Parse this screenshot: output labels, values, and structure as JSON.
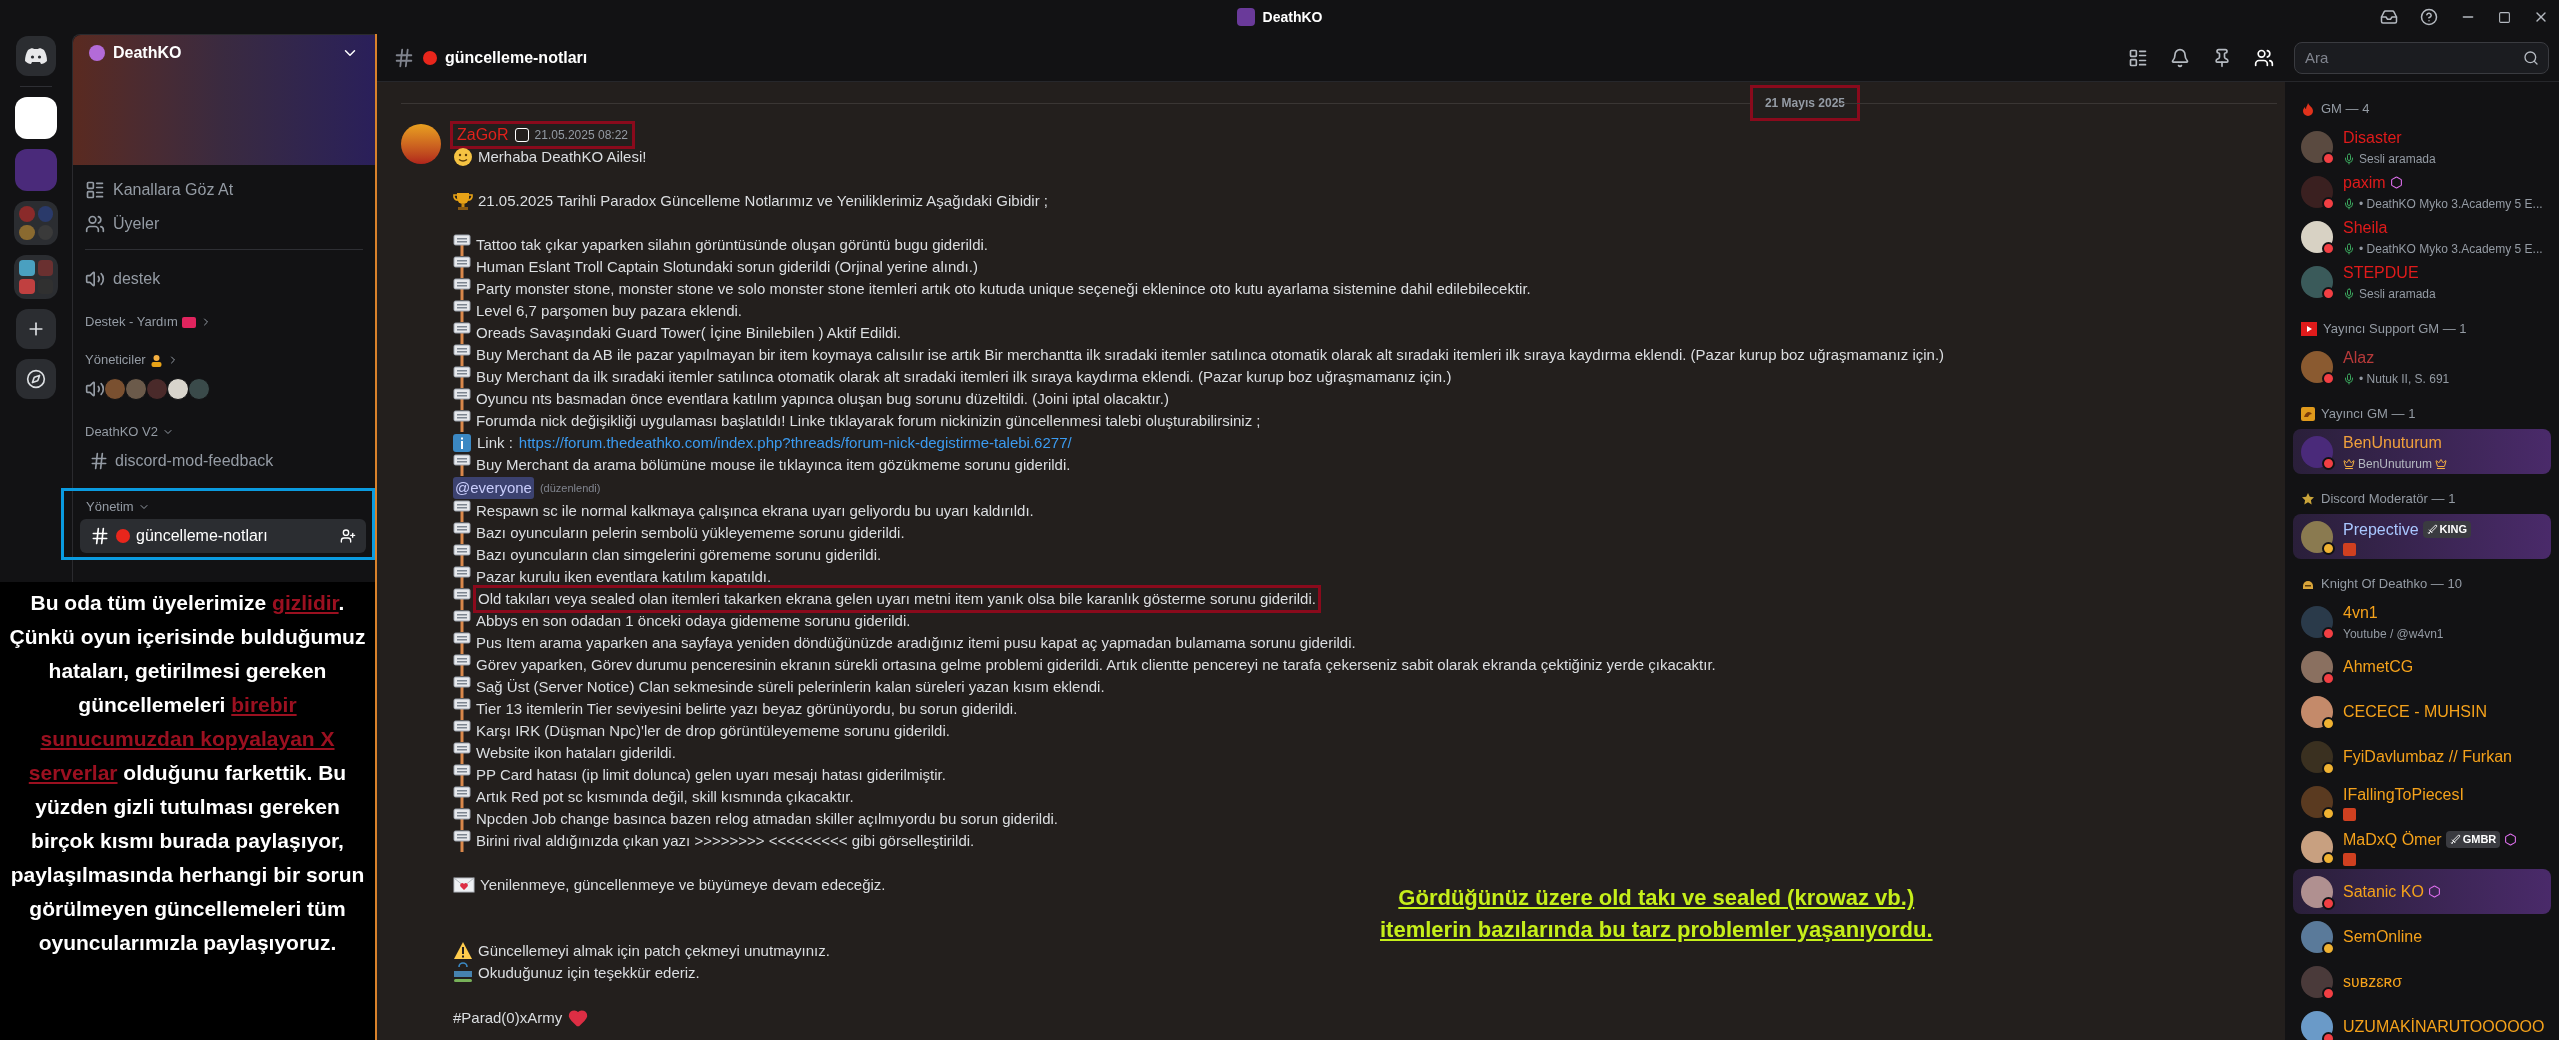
{
  "titlebar": {
    "title": "DeathKO"
  },
  "server": {
    "name": "DeathKO"
  },
  "sidebar": {
    "items": [
      {
        "kind": "browse",
        "label": "Kanallara Göz At"
      },
      {
        "kind": "members",
        "label": "Üyeler"
      },
      {
        "kind": "separator"
      },
      {
        "kind": "voice",
        "label": "destek"
      },
      {
        "kind": "category",
        "label": "Destek - Yardım",
        "expanded": false,
        "emoji": true
      },
      {
        "kind": "category",
        "label": "Yöneticiler",
        "expanded": false,
        "emoji": true
      },
      {
        "kind": "voice-users"
      },
      {
        "kind": "category",
        "label": "DeathKO V2",
        "expanded": true
      },
      {
        "kind": "text",
        "label": "discord-mod-feedback",
        "selected": false
      }
    ],
    "framed_group": [
      {
        "kind": "category",
        "label": "Yönetim",
        "expanded": true
      },
      {
        "kind": "text",
        "label": "güncelleme-notları",
        "selected": true,
        "dot": true
      }
    ]
  },
  "note": [
    {
      "text": "Bu oda tüm üyelerimize ",
      "emphasis": false
    },
    {
      "text": "gizlidir",
      "emphasis": true
    },
    {
      "text": ". Çünkü oyun içerisinde bulduğumuz hataları, getirilmesi gereken güncellemeleri ",
      "emphasis": false
    },
    {
      "text": "birebir sunucumuzdan kopyalayan X serverlar",
      "emphasis": true
    },
    {
      "text": " olduğunu farkettik. Bu yüzden gizli tutulması gereken birçok kısmı burada paylaşıyor, paylaşılmasında herhangi bir sorun görülmeyen güncellemeleri tüm oyuncularımızla paylaşıyoruz.",
      "emphasis": false
    }
  ],
  "channel": {
    "name": "güncelleme-notları"
  },
  "search": {
    "placeholder": "Ara"
  },
  "message": {
    "date": "21 Mayıs 2025",
    "date_highlighted": true,
    "author": "ZaGoR",
    "author_highlighted": true,
    "timestamp": "21.05.2025 08:22",
    "lines": [
      {
        "kind": "greeting",
        "text": "Merhaba DeathKO Ailesi!"
      },
      {
        "kind": "gap"
      },
      {
        "kind": "trophy",
        "text": "21.05.2025 Tarihli Paradox Güncelleme Notlarımız ve Yeniliklerimiz Aşağıdaki Gibidir ;"
      },
      {
        "kind": "gap"
      },
      {
        "kind": "bullet",
        "text": "Tattoo tak çıkar yaparken silahın görüntüsünde oluşan görüntü bugu giderildi.",
        "highlighted": false
      },
      {
        "kind": "bullet",
        "text": "Human Eslant Troll Captain Slotundaki sorun giderildi (Orjinal yerine alındı.)",
        "highlighted": false
      },
      {
        "kind": "bullet",
        "text": "Party monster stone, monster stone ve solo monster stone itemleri artık oto kutuda unique seçeneği eklenince oto kutu ayarlama sistemine dahil edilebilecektir.",
        "highlighted": false
      },
      {
        "kind": "bullet",
        "text": "Level 6,7 parşomen buy pazara eklendi.",
        "highlighted": false
      },
      {
        "kind": "bullet",
        "text": "Oreads Savaşındaki Guard Tower( İçine Binilebilen ) Aktif Edildi.",
        "highlighted": false
      },
      {
        "kind": "bullet",
        "text": "Buy Merchant da AB ile pazar yapılmayan bir item koymaya calısılır ise artık Bir merchantta ilk sıradaki itemler satılınca otomatik olarak alt sıradaki itemleri ilk sıraya kaydırma eklendi. (Pazar kurup boz uğraşmamanız için.)",
        "highlighted": false
      },
      {
        "kind": "bullet",
        "text": "Buy Merchant da ilk sıradaki itemler satılınca otomatik olarak alt sıradaki itemleri ilk sıraya kaydırma eklendi. (Pazar kurup boz uğraşmamanız için.)",
        "highlighted": false
      },
      {
        "kind": "bullet",
        "text": "Oyuncu nts basmadan önce eventlara katılım yapınca oluşan bug sorunu düzeltildi. (Joini iptal olacaktır.)",
        "highlighted": false
      },
      {
        "kind": "bullet",
        "text": "Forumda nick değişikliği uygulaması başlatıldı! Linke tıklayarak forum nickinizin güncellenmesi talebi oluşturabilirsiniz ;",
        "highlighted": false
      },
      {
        "kind": "link",
        "text": "Link :",
        "url": "https://forum.thedeathko.com/index.php?threads/forum-nick-degistirme-talebi.6277/"
      },
      {
        "kind": "bullet",
        "text": "Buy Merchant da arama bölümüne mouse ile tıklayınca item gözükmeme sorunu giderildi.",
        "highlighted": false
      },
      {
        "kind": "mention",
        "text": "@everyone",
        "edited": "(düzenlendi)"
      },
      {
        "kind": "bullet",
        "text": "Respawn sc ile normal kalkmaya çalışınca ekrana uyarı geliyordu bu uyarı kaldırıldı.",
        "highlighted": false
      },
      {
        "kind": "bullet",
        "text": "Bazı oyuncuların pelerin sembolü yükleyememe sorunu giderildi.",
        "highlighted": false
      },
      {
        "kind": "bullet",
        "text": "Bazı oyuncuların clan simgelerini görememe sorunu giderildi.",
        "highlighted": false
      },
      {
        "kind": "bullet",
        "text": "Pazar kurulu iken eventlara katılım kapatıldı.",
        "highlighted": false
      },
      {
        "kind": "bullet",
        "text": "Old takıları veya sealed olan itemleri takarken ekrana gelen uyarı metni item yanık olsa bile karanlık gösterme sorunu giderildi.",
        "highlighted": true
      },
      {
        "kind": "bullet",
        "text": "Abbys en son odadan 1 önceki odaya gidememe sorunu giderildi.",
        "highlighted": false
      },
      {
        "kind": "bullet",
        "text": "Pus Item arama yaparken ana sayfaya yeniden döndüğünüzde aradığınız itemi pusu kapat aç yapmadan bulamama sorunu giderildi.",
        "highlighted": false
      },
      {
        "kind": "bullet",
        "text": "Görev yaparken, Görev durumu penceresinin ekranın sürekli ortasına gelme problemi giderildi. Artık clientte pencereyi ne tarafa çekerseniz sabit olarak ekranda çektiğiniz yerde çıkacaktır.",
        "highlighted": false
      },
      {
        "kind": "bullet",
        "text": "Sağ Üst (Server Notice) Clan sekmesinde süreli pelerinlerin kalan süreleri yazan kısım eklendi.",
        "highlighted": false
      },
      {
        "kind": "bullet",
        "text": "Tier 13 itemlerin Tier seviyesini belirte yazı beyaz görünüyordu, bu sorun giderildi.",
        "highlighted": false
      },
      {
        "kind": "bullet",
        "text": "Karşı IRK (Düşman Npc)'ler de drop görüntüleyememe sorunu giderildi.",
        "highlighted": false
      },
      {
        "kind": "bullet",
        "text": "Website ikon hataları giderildi.",
        "highlighted": false
      },
      {
        "kind": "bullet",
        "text": "PP Card hatası (ip limit dolunca) gelen uyarı mesajı hatası giderilmiştir.",
        "highlighted": false
      },
      {
        "kind": "bullet",
        "text": "Artık Red pot sc kısmında değil, skill kısmında çıkacaktır.",
        "highlighted": false
      },
      {
        "kind": "bullet",
        "text": "Npcden Job change basınca bazen relog atmadan skiller açılmıyordu bu sorun giderildi.",
        "highlighted": false
      },
      {
        "kind": "bullet",
        "text": "Birini rival aldığınızda çıkan yazı >>>>>>>> <<<<<<<<<  gibi görselleştirildi.",
        "highlighted": false
      },
      {
        "kind": "gap"
      },
      {
        "kind": "letter",
        "text": "Yenilenmeye, güncellenmeye ve büyümeye devam edeceğiz."
      },
      {
        "kind": "gap"
      },
      {
        "kind": "gap"
      },
      {
        "kind": "warning",
        "text": "Güncellemeyi almak için patch çekmeyi unutmayınız."
      },
      {
        "kind": "update",
        "text": "Okuduğunuz için teşekkür ederiz."
      },
      {
        "kind": "gap"
      },
      {
        "kind": "signature",
        "text": "#Parad(0)xArmy"
      }
    ]
  },
  "annotation": {
    "lines": [
      "Gördüğünüz üzere old takı ve sealed (krowaz vb.)",
      "itemlerin bazılarında bu tarz problemler yaşanıyordu."
    ]
  },
  "member_groups": [
    {
      "title": "GM — 4",
      "members": [
        {
          "name": "Disaster",
          "color": "#e01b1b",
          "idle": false,
          "voice": true,
          "subtitle": "Sesli aramada",
          "boost": false,
          "highlighted": false
        },
        {
          "name": "paxim",
          "color": "#e01b1b",
          "idle": false,
          "voice": true,
          "subtitle": "• DeathKO Myko 3.Academy 5 E...",
          "boost": true,
          "highlighted": false
        },
        {
          "name": "Sheila",
          "color": "#e01b1b",
          "idle": false,
          "voice": true,
          "subtitle": "• DeathKO Myko 3.Academy 5 E...",
          "boost": false,
          "highlighted": false
        },
        {
          "name": "STEPDUE",
          "color": "#e01b1b",
          "idle": false,
          "voice": true,
          "subtitle": "Sesli aramada",
          "boost": false,
          "highlighted": false
        }
      ]
    },
    {
      "title": "Yayıncı Support GM — 1",
      "members": [
        {
          "name": "Alaz",
          "color": "#b83a3a",
          "idle": false,
          "voice": true,
          "subtitle": "• Nutuk II, S. 691",
          "boost": false,
          "highlighted": false
        }
      ]
    },
    {
      "title": "Yayıncı GM — 1",
      "members": [
        {
          "name": "BenUnuturum",
          "color": "#f0a03c",
          "idle": false,
          "voice": false,
          "crowned_subtitle": "BenUnuturum",
          "boost": false,
          "highlighted": true
        }
      ]
    },
    {
      "title": "Discord Moderatör — 1",
      "members": [
        {
          "name": "Prepective",
          "color": "#a9c7ff",
          "idle": true,
          "voice": false,
          "tag": "KING",
          "emoji_subtitle": true,
          "boost": false,
          "highlighted": true
        }
      ]
    },
    {
      "title": "Knight Of Deathko — 10",
      "members": [
        {
          "name": "4vn1",
          "color": "#f5a21b",
          "idle": false,
          "voice": false,
          "subtitle": "Youtube / @w4vn1",
          "boost": false,
          "highlighted": false
        },
        {
          "name": "AhmetCG",
          "color": "#f5a21b",
          "idle": false,
          "voice": false,
          "boost": false,
          "highlighted": false
        },
        {
          "name": "CECECE - MUHSIN",
          "color": "#f5a21b",
          "idle": true,
          "voice": false,
          "boost": false,
          "highlighted": false
        },
        {
          "name": "FyiDavlumbaz // Furkan",
          "color": "#f5a21b",
          "idle": true,
          "voice": false,
          "boost": false,
          "highlighted": false
        },
        {
          "name": "IFallingToPiecesI",
          "color": "#f5a21b",
          "idle": true,
          "voice": false,
          "emoji_subtitle": true,
          "boost": false,
          "highlighted": false
        },
        {
          "name": "MaDxQ Ömer",
          "color": "#f5a21b",
          "idle": true,
          "voice": false,
          "tag": "GMBR",
          "emoji_subtitle": true,
          "boost": true,
          "highlighted": false
        },
        {
          "name": "Satanic KO",
          "color": "#f5a21b",
          "idle": false,
          "voice": false,
          "boost": true,
          "highlighted": true
        },
        {
          "name": "SemOnline",
          "color": "#f5a21b",
          "idle": true,
          "voice": false,
          "boost": false,
          "highlighted": false
        },
        {
          "name": "sʋʙzɛʀσ",
          "color": "#f5a21b",
          "idle": false,
          "voice": false,
          "boost": false,
          "highlighted": false
        },
        {
          "name": "UZUMAKİNARUTOOOOOO",
          "color": "#f5a21b",
          "idle": false,
          "voice": false,
          "boost": false,
          "highlighted": false
        }
      ]
    }
  ]
}
